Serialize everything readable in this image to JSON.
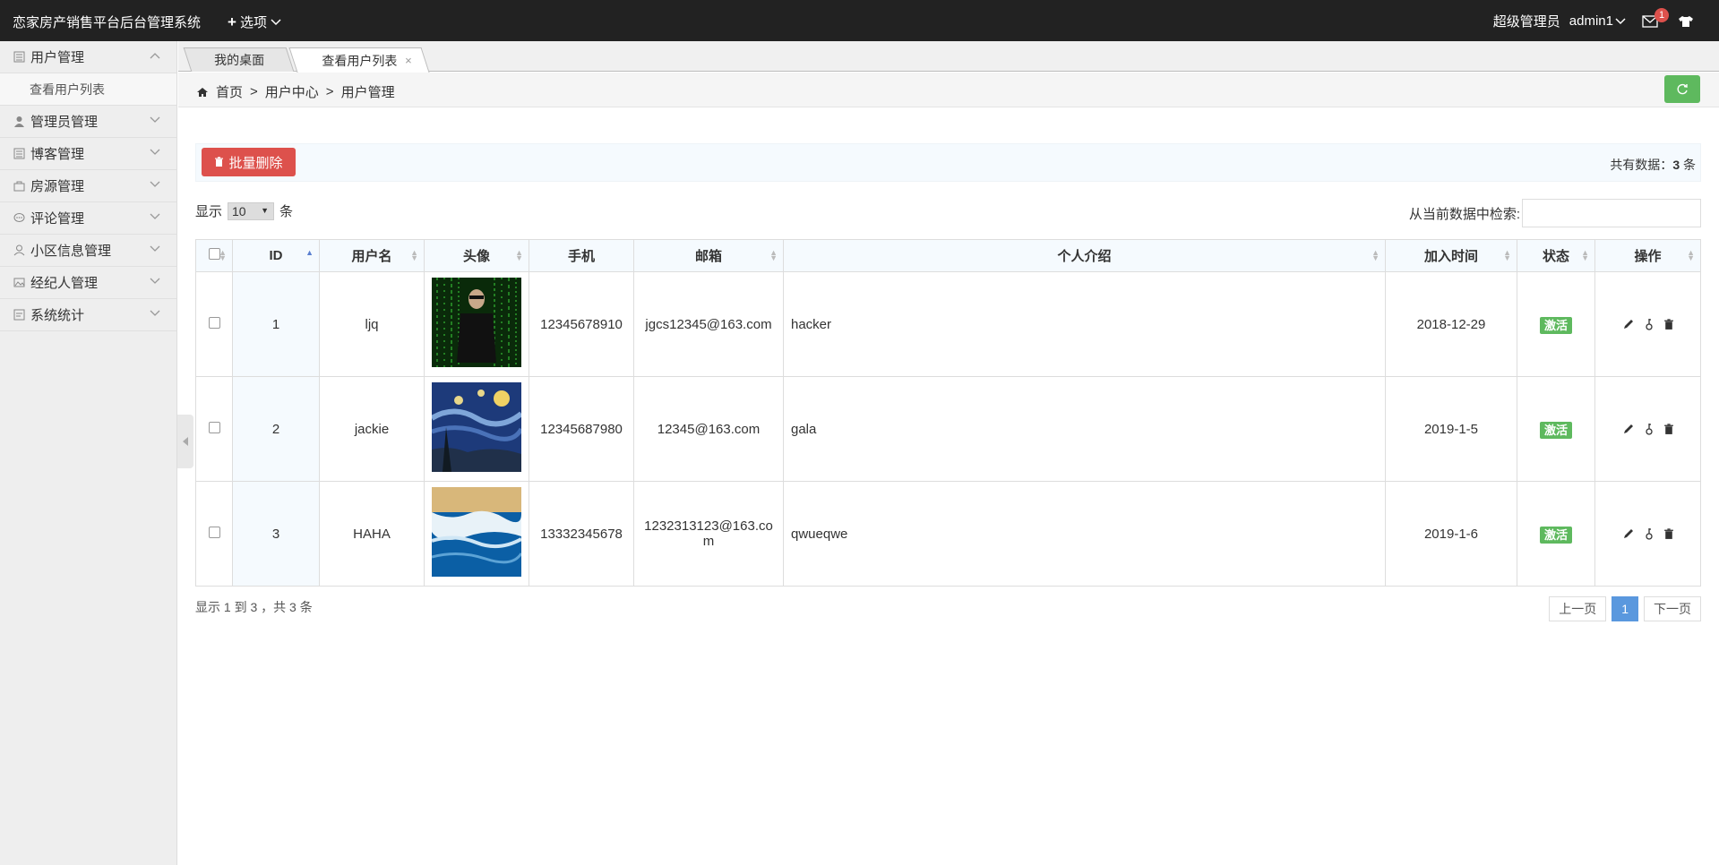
{
  "app": {
    "title": "恋家房产销售平台后台管理系统",
    "options_label": "选项"
  },
  "header": {
    "role": "超级管理员",
    "username": "admin1",
    "mail_count": "1"
  },
  "sidebar": {
    "items": [
      {
        "label": "用户管理",
        "icon": "list-icon",
        "expanded": true
      },
      {
        "label": "管理员管理",
        "icon": "user-icon"
      },
      {
        "label": "博客管理",
        "icon": "list-icon"
      },
      {
        "label": "房源管理",
        "icon": "bag-icon"
      },
      {
        "label": "评论管理",
        "icon": "comment-icon"
      },
      {
        "label": "小区信息管理",
        "icon": "user-outline-icon"
      },
      {
        "label": "经纪人管理",
        "icon": "image-icon"
      },
      {
        "label": "系统统计",
        "icon": "chart-icon"
      }
    ],
    "sub": [
      "查看用户列表"
    ]
  },
  "tabs": [
    {
      "label": "我的桌面"
    },
    {
      "label": "查看用户列表",
      "close": "×"
    }
  ],
  "breadcrumb": {
    "home": "首页",
    "sep": ">",
    "level1": "用户中心",
    "level2": "用户管理"
  },
  "toolbar": {
    "batch_delete": "批量删除",
    "total_prefix": "共有数据：",
    "total_count": "3",
    "total_suffix": " 条"
  },
  "length": {
    "prefix": "显示",
    "value": "10",
    "suffix": "条"
  },
  "search": {
    "label": "从当前数据中检索:",
    "value": ""
  },
  "table": {
    "headers": [
      "ID",
      "用户名",
      "头像",
      "手机",
      "邮箱",
      "个人介绍",
      "加入时间",
      "状态",
      "操作"
    ],
    "rows": [
      {
        "id": "1",
        "username": "ljq",
        "avatar": "matrix-avatar",
        "phone": "12345678910",
        "email": "jgcs12345@163.com",
        "intro": "hacker",
        "joined": "2018-12-29",
        "status": "激活"
      },
      {
        "id": "2",
        "username": "jackie",
        "avatar": "starry-night-avatar",
        "phone": "12345687980",
        "email": "12345@163.com",
        "intro": "gala",
        "joined": "2019-1-5",
        "status": "激活"
      },
      {
        "id": "3",
        "username": "HAHA",
        "avatar": "ocean-wave-avatar",
        "phone": "13332345678",
        "email": "1232313123@163.com",
        "intro": "qwueqwe",
        "joined": "2019-1-6",
        "status": "激活"
      }
    ]
  },
  "footer": {
    "info": "显示 1 到 3 ，共 3 条",
    "prev": "上一页",
    "page": "1",
    "next": "下一页"
  },
  "colors": {
    "topbar": "#222222",
    "danger": "#dd514c",
    "success": "#5eb95e",
    "primary": "#5a98de"
  }
}
